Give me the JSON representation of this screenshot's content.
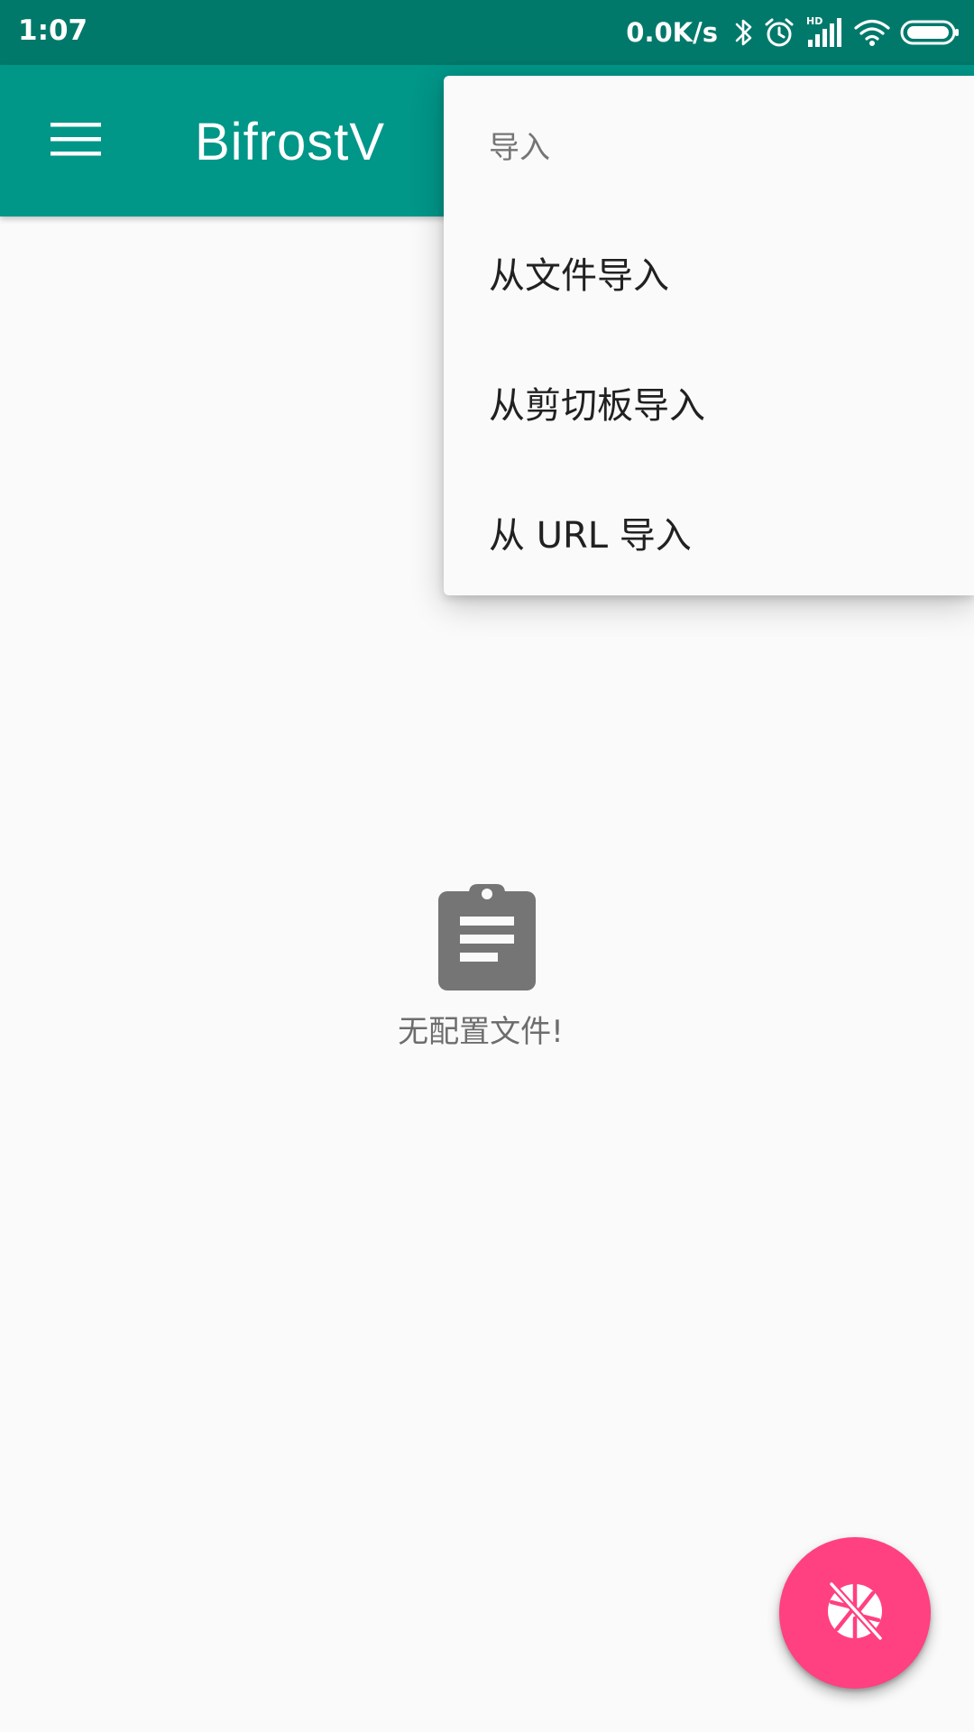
{
  "status_bar": {
    "time": "1:07",
    "net_speed": "0.0K/s",
    "icons": [
      "bluetooth-icon",
      "alarm-icon",
      "hd-signal-icon",
      "wifi-icon",
      "battery-icon"
    ],
    "color": "#00796b"
  },
  "app_bar": {
    "title": "BifrostV",
    "menu_icon": "hamburger-menu-icon",
    "color": "#009688"
  },
  "menu": {
    "header": "导入",
    "items": [
      {
        "label": "从文件导入"
      },
      {
        "label": "从剪切板导入"
      },
      {
        "label": "从 URL 导入"
      }
    ]
  },
  "empty_state": {
    "icon": "clipboard-icon",
    "message": "无配置文件!"
  },
  "fab": {
    "icon": "shutter-off-icon",
    "color": "#ff4081"
  }
}
